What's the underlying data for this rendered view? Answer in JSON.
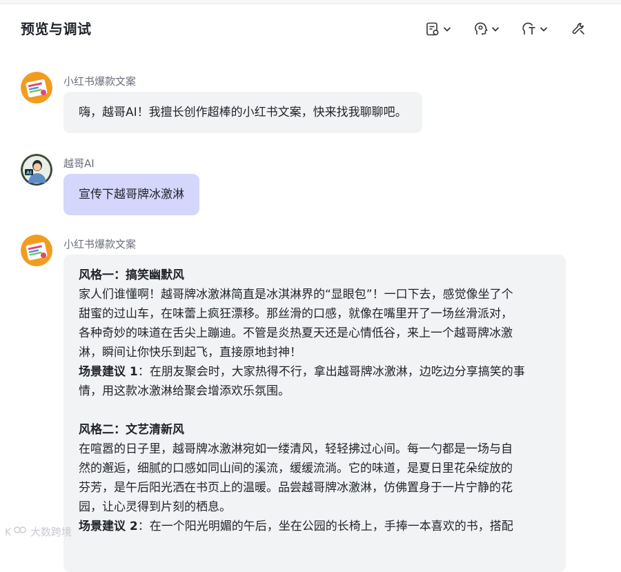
{
  "header": {
    "title": "预览与调试",
    "icons": [
      "document-settings-icon",
      "head-brain-icon",
      "voice-text-icon",
      "wrench-icon"
    ]
  },
  "colors": {
    "user_bubble": "#d4d6fc",
    "bot_bubble": "#f2f3f5",
    "name_text": "#6b6f7a"
  },
  "messages": [
    {
      "sender": "小红书爆款文案",
      "text": "嗨，越哥AI！我擅长创作超棒的小红书文案，快来找我聊聊吧。"
    },
    {
      "sender": "越哥AI",
      "text": "宣传下越哥牌冰激淋"
    },
    {
      "sender": "小红书爆款文案",
      "style1_title": "风格一：搞笑幽默风",
      "style1_body": [
        "家人们谁懂啊！越哥牌冰激淋简直是冰淇淋界的“显眼包”！一口下去，感觉像坐了个",
        "甜蜜的过山车，在味蕾上疯狂漂移。那丝滑的口感，就像在嘴里开了一场丝滑派对，",
        "各种奇妙的味道在舌尖上蹦迪。不管是炎热夏天还是心情低谷，来上一个越哥牌冰激",
        "淋，瞬间让你快乐到起飞，直接原地封神！"
      ],
      "scene1_label": "场景建议 1",
      "scene1_lines": [
        "：在朋友聚会时，大家热得不行，拿出越哥牌冰激淋，边吃边分享搞笑的事",
        "情，用这款冰激淋给聚会增添欢乐氛围。"
      ],
      "style2_title": "风格二：文艺清新风",
      "style2_body": [
        "在喧嚣的日子里，越哥牌冰激淋宛如一缕清风，轻轻拂过心间。每一勺都是一场与自",
        "然的邂逅，细腻的口感如同山间的溪流，缓缓流淌。它的味道，是夏日里花朵绽放的",
        "芬芳，是午后阳光洒在书页上的温暖。品尝越哥牌冰激淋，仿佛置身于一片宁静的花",
        "园，让心灵得到片刻的栖息。"
      ],
      "scene2_label": "场景建议 2",
      "scene2_line": "：在一个阳光明媚的午后，坐在公园的长椅上，手捧一本喜欢的书，搭配"
    }
  ],
  "watermark": "大数跨境"
}
